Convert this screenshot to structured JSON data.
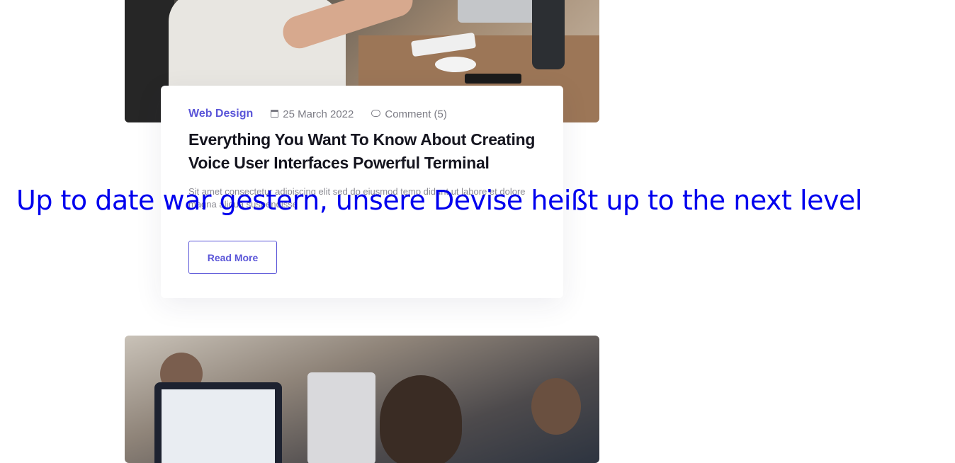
{
  "post1": {
    "image_alt": "Man working at desk with laptop",
    "category": "Web Design",
    "date": "25 March 2022",
    "comments": "Comment (5)",
    "title": "Everything You Want To Know About Creating Voice User Interfaces Powerful Terminal",
    "excerpt": "Sit amet consectetur adipiscing elit sed do eiusmod temp didunt ut labore et dolore magna aliqua suspendisse",
    "read_more_label": "Read More"
  },
  "post2": {
    "image_alt": "People working on computers in office"
  },
  "overlay": {
    "text": "Up to date war gestern, unsere Devise heißt up to the next level"
  },
  "colors": {
    "accent": "#5a55d8",
    "overlay_text": "#0000ee",
    "title": "#15151f",
    "muted": "#7c7c85"
  },
  "icons": {
    "date": "calendar-icon",
    "comments": "chat-bubble-icon"
  }
}
